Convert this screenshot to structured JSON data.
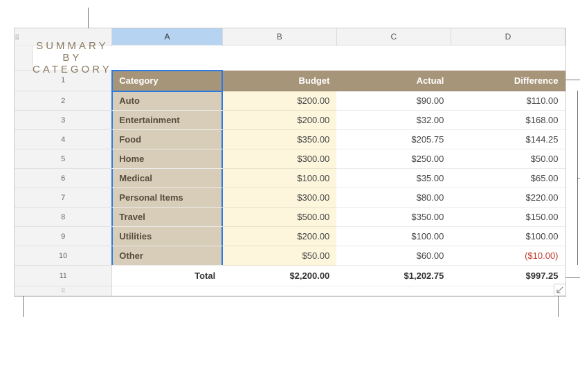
{
  "columns": {
    "A": "A",
    "B": "B",
    "C": "C",
    "D": "D"
  },
  "title": "SUMMARY BY CATEGORY",
  "headers": {
    "category": "Category",
    "budget": "Budget",
    "actual": "Actual",
    "difference": "Difference"
  },
  "rows": [
    {
      "n": "1"
    },
    {
      "n": "2",
      "category": "Auto",
      "budget": "$200.00",
      "actual": "$90.00",
      "diff": "$110.00",
      "neg": false
    },
    {
      "n": "3",
      "category": "Entertainment",
      "budget": "$200.00",
      "actual": "$32.00",
      "diff": "$168.00",
      "neg": false
    },
    {
      "n": "4",
      "category": "Food",
      "budget": "$350.00",
      "actual": "$205.75",
      "diff": "$144.25",
      "neg": false
    },
    {
      "n": "5",
      "category": "Home",
      "budget": "$300.00",
      "actual": "$250.00",
      "diff": "$50.00",
      "neg": false
    },
    {
      "n": "6",
      "category": "Medical",
      "budget": "$100.00",
      "actual": "$35.00",
      "diff": "$65.00",
      "neg": false
    },
    {
      "n": "7",
      "category": "Personal Items",
      "budget": "$300.00",
      "actual": "$80.00",
      "diff": "$220.00",
      "neg": false
    },
    {
      "n": "8",
      "category": "Travel",
      "budget": "$500.00",
      "actual": "$350.00",
      "diff": "$150.00",
      "neg": false
    },
    {
      "n": "9",
      "category": "Utilities",
      "budget": "$200.00",
      "actual": "$100.00",
      "diff": "$100.00",
      "neg": false
    },
    {
      "n": "10",
      "category": "Other",
      "budget": "$50.00",
      "actual": "$60.00",
      "diff": "($10.00)",
      "neg": true
    }
  ],
  "total": {
    "n": "11",
    "label": "Total",
    "budget": "$2,200.00",
    "actual": "$1,202.75",
    "diff": "$997.25"
  }
}
